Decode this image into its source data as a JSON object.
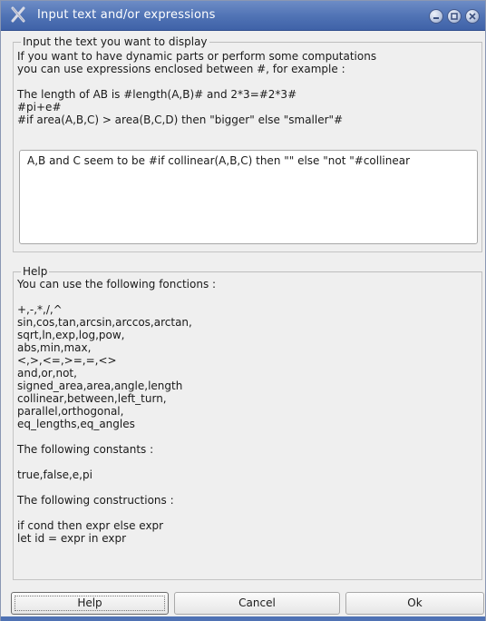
{
  "window": {
    "title": "Input text and/or expressions"
  },
  "input_section": {
    "legend": "Input the text you want to display",
    "lines": [
      "If you want to have dynamic parts or perform some computations",
      "you can use expressions enclosed between #, for example :",
      "",
      "The length of AB is #length(A,B)# and 2*3=#2*3#",
      "#pi+e#",
      "#if area(A,B,C) > area(B,C,D) then \"bigger\" else \"smaller\"#"
    ],
    "editor_value": "A,B and C seem to be #if collinear(A,B,C) then \"\" else \"not \"#collinear"
  },
  "help_section": {
    "legend": "Help",
    "lines": [
      "You can use the following fonctions :",
      "",
      "+,-,*,/,^",
      "sin,cos,tan,arcsin,arccos,arctan,",
      "sqrt,ln,exp,log,pow,",
      "abs,min,max,",
      "<,>,<=,>=,=,<>",
      "and,or,not,",
      "signed_area,area,angle,length",
      "collinear,between,left_turn,",
      "parallel,orthogonal,",
      "eq_lengths,eq_angles",
      "",
      "The following constants :",
      "",
      "true,false,e,pi",
      "",
      "The following constructions :",
      "",
      "if cond then expr else expr",
      "let id = expr in expr"
    ]
  },
  "buttons": {
    "help": "Help",
    "cancel": "Cancel",
    "ok": "Ok"
  },
  "icons": {
    "app": "app-x-icon",
    "minimize": "minimize-icon",
    "maximize": "maximize-icon",
    "close": "close-icon"
  }
}
